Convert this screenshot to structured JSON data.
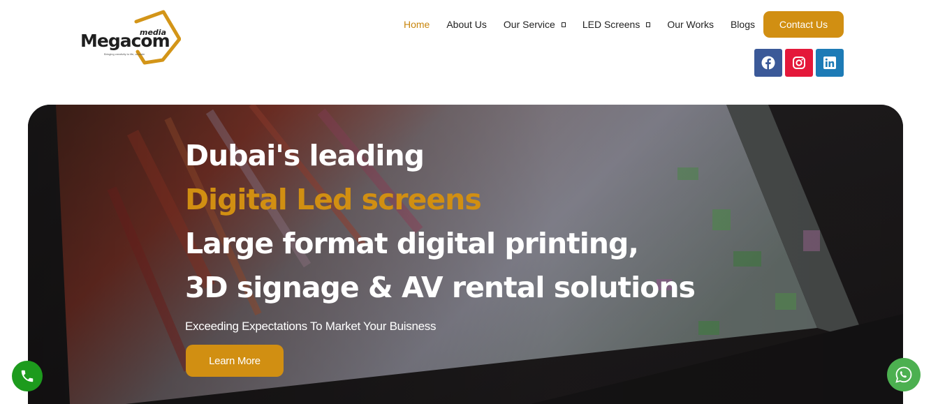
{
  "logo": {
    "word": "Megacom",
    "suffix": "media",
    "tagline": "Bringing creativity to life, at scale"
  },
  "nav": {
    "items": [
      {
        "label": "Home",
        "active": true
      },
      {
        "label": "About Us"
      },
      {
        "label": "Our Service",
        "has_dropdown": true
      },
      {
        "label": "LED Screens",
        "has_dropdown": true
      },
      {
        "label": "Our Works"
      },
      {
        "label": "Blogs"
      }
    ],
    "cta": "Contact Us"
  },
  "socials": [
    {
      "icon": "facebook-icon",
      "color": "#3b5998"
    },
    {
      "icon": "instagram-icon",
      "color": "#e4183a"
    },
    {
      "icon": "linkedin-icon",
      "color": "#1d7bb6"
    }
  ],
  "hero": {
    "line1": "Dubai's leading",
    "line2": "Digital Led screens",
    "line3": "Large format digital printing,",
    "line4": "3D signage  & AV rental solutions",
    "subtitle": "Exceeding Expectations To Market Your Buisness",
    "button": "Learn More"
  },
  "floating": {
    "call_icon": "phone-icon",
    "whatsapp_icon": "whatsapp-icon"
  },
  "colors": {
    "accent": "#d18f12",
    "call": "#1d9b1d",
    "whatsapp": "#4cb050"
  }
}
